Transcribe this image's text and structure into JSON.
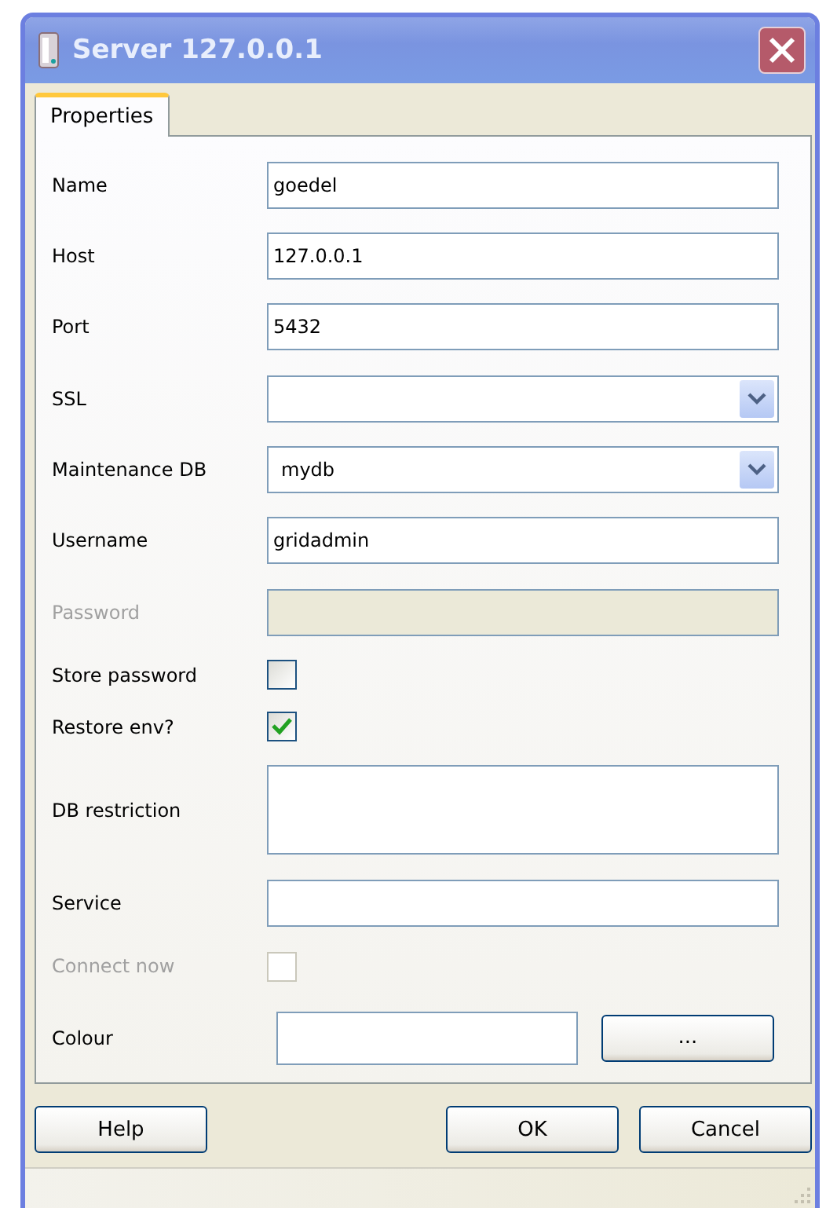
{
  "window": {
    "title": "Server 127.0.0.1"
  },
  "tabs": [
    {
      "label": "Properties",
      "selected": true
    }
  ],
  "fields": [
    {
      "kind": "text",
      "label": "Name",
      "value": "goedel",
      "disabled": false
    },
    {
      "kind": "text",
      "label": "Host",
      "value": "127.0.0.1",
      "disabled": false
    },
    {
      "kind": "text",
      "label": "Port",
      "value": "5432",
      "disabled": false
    },
    {
      "kind": "combo",
      "label": "SSL",
      "disabled": false
    },
    {
      "kind": "combo",
      "label": "Maintenance DB",
      "value": "mydb",
      "disabled": false
    },
    {
      "kind": "text",
      "label": "Username",
      "value": "gridadmin",
      "disabled": false
    },
    {
      "kind": "text",
      "label": "Password",
      "disabled": true
    },
    {
      "kind": "checkbox",
      "label": "Store password",
      "checked": false,
      "disabled": false
    },
    {
      "kind": "checkbox",
      "label": "Restore env?",
      "checked": true,
      "disabled": false
    },
    {
      "kind": "multiline",
      "label": "DB restriction",
      "disabled": false
    },
    {
      "kind": "text",
      "label": "Service",
      "disabled": false
    },
    {
      "kind": "checkbox",
      "label": "Connect now",
      "checked": false,
      "disabled": true
    },
    {
      "kind": "colour",
      "label": "Colour",
      "button": "...",
      "disabled": false
    }
  ],
  "help_button": {
    "label": "Help"
  },
  "buttons": [
    {
      "label": "OK"
    },
    {
      "label": "Cancel"
    }
  ]
}
